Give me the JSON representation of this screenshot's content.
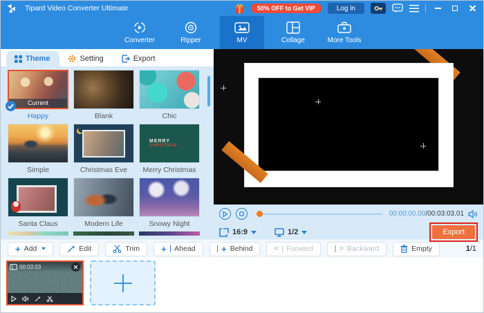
{
  "window": {
    "title": "Tipard Video Converter Ultimate"
  },
  "titlebar": {
    "vip_badge": "50% OFF to Get VIP",
    "login_label": "Log in"
  },
  "nav": {
    "tabs": [
      {
        "label": "Converter",
        "active": false
      },
      {
        "label": "Ripper",
        "active": false
      },
      {
        "label": "MV",
        "active": true
      },
      {
        "label": "Collage",
        "active": false
      },
      {
        "label": "More Tools",
        "active": false
      }
    ]
  },
  "panel_tabs": [
    {
      "label": "Theme",
      "active": true
    },
    {
      "label": "Setting",
      "active": false
    },
    {
      "label": "Export",
      "active": false
    }
  ],
  "themes": [
    {
      "name": "Happy",
      "badge": "Current",
      "selected": true
    },
    {
      "name": "Blank"
    },
    {
      "name": "Chic"
    },
    {
      "name": "Simple"
    },
    {
      "name": "Christmas Eve"
    },
    {
      "name": "Merry Christmas",
      "thumb_line1": "MERRY",
      "thumb_line2": "CHRISTMAS"
    },
    {
      "name": "Santa Claus"
    },
    {
      "name": "Modern Life"
    },
    {
      "name": "Snowy Night"
    }
  ],
  "player": {
    "time_current": "00:00:00.00",
    "time_separator": "/",
    "time_total": "00:03:03.01",
    "aspect_ratio": "16:9",
    "screen_page": "1/2",
    "export_label": "Export"
  },
  "toolbar": {
    "add": "Add",
    "edit": "Edit",
    "trim": "Trim",
    "ahead": "Ahead",
    "behind": "Behind",
    "forward": "Forward",
    "backward": "Backward",
    "empty": "Empty",
    "page_current": "1",
    "page_separator": "/",
    "page_total": "1"
  },
  "timeline": {
    "clip_duration": "00:03:03"
  },
  "colors": {
    "header_blue": "#2E8CE0",
    "active_tab_blue": "#1A73CB",
    "accent_blue": "#2D7FD0",
    "vip_red": "#F04A38",
    "panel_bg": "#D8EAF8",
    "export_orange": "#EE7140",
    "highlight_red": "#E0211A",
    "selection_orange": "#E8502E",
    "tape_orange": "#DD7A22"
  }
}
